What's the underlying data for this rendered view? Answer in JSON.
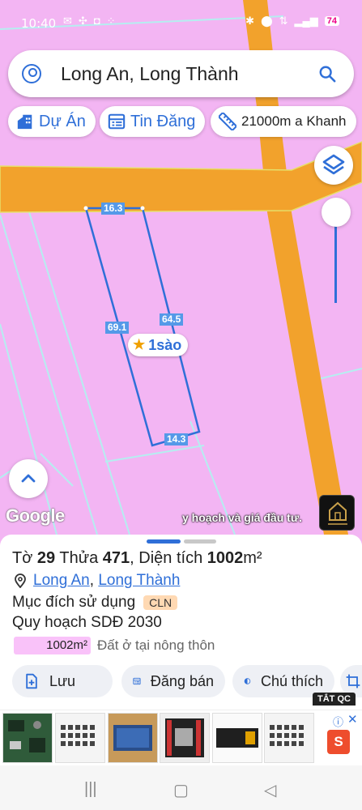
{
  "status_bar": {
    "time": "10:40",
    "battery": "74"
  },
  "search": {
    "query": "Long An, Long Thành",
    "user_icon": "user-circle-icon",
    "search_icon": "search-icon"
  },
  "filter_chips": [
    {
      "label": "Dự Án",
      "icon": "building-icon"
    },
    {
      "label": "Tin Đăng",
      "icon": "listing-icon"
    },
    {
      "label": "21000m a Khanh",
      "icon": "ruler-icon"
    }
  ],
  "map": {
    "edge_labels": {
      "top": "16.3",
      "left": "69.1",
      "right": "64.5",
      "bottom": "14.3"
    },
    "area_label": "1sào",
    "watermark": "Google",
    "scrolling_text": "y hoạch và giá đầu tư.",
    "colors": {
      "land": "#f3b5f3",
      "road": "#f2a22c",
      "plot_outline": "#2f6fd8"
    }
  },
  "details": {
    "sheet_prefix": "Tờ",
    "sheet_no": "29",
    "parcel_prefix": "Thửa",
    "parcel_no": "471",
    "area_prefix": ", Diện tích",
    "area_value": "1002",
    "area_unit": "m²",
    "province": "Long An",
    "separator": ", ",
    "district": "Long Thành",
    "usage_label": "Mục đích sử dụng",
    "usage_code": "CLN",
    "plan_title": "Quy hoạch SDĐ 2030",
    "plan_area": "1002m²",
    "plan_use": "Đất ở tại nông thôn"
  },
  "actions": [
    {
      "label": "Lưu",
      "icon": "add-file-icon"
    },
    {
      "label": "Đăng bán",
      "icon": "listing-icon"
    },
    {
      "label": "Chú thích",
      "icon": "half-circle-icon"
    }
  ],
  "ad": {
    "badge": "TẮT QC",
    "info_icon": "info-icon",
    "close_icon": "close-icon",
    "shop_icon": "shopee-bag-icon"
  }
}
